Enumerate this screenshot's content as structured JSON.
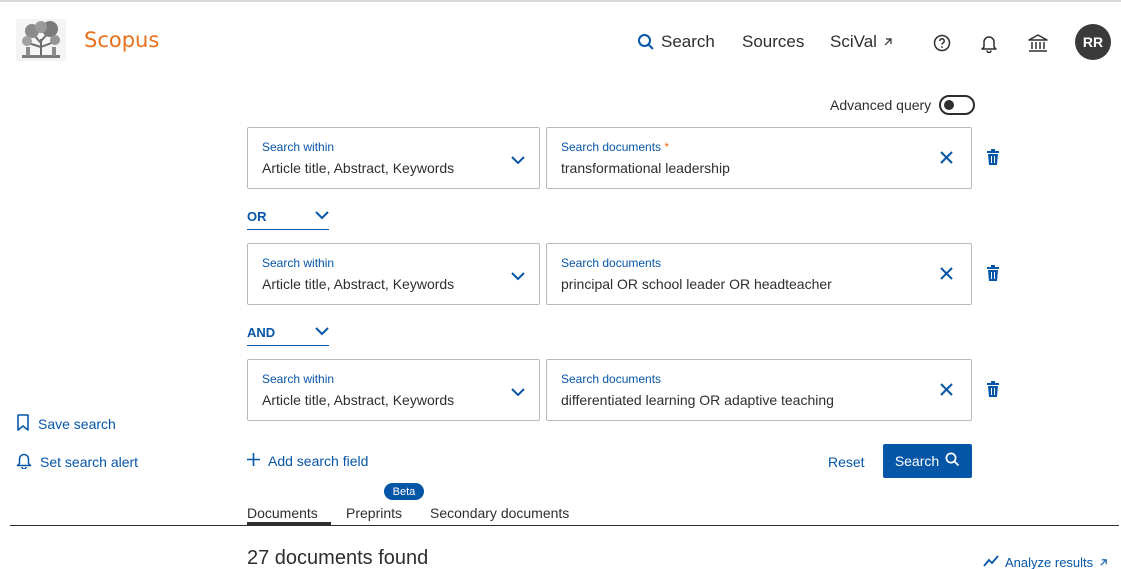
{
  "header": {
    "brand": "Scopus",
    "nav": {
      "search": "Search",
      "sources": "Sources",
      "scival": "SciVal"
    },
    "avatar_initials": "RR",
    "icons": [
      "help-icon",
      "bell-icon",
      "institution-icon"
    ]
  },
  "advanced_query_label": "Advanced query",
  "rows": [
    {
      "within_label": "Search within",
      "within_value": "Article title, Abstract, Keywords",
      "docs_label": "Search documents",
      "required_mark": "*",
      "docs_value": "transformational leadership"
    },
    {
      "within_label": "Search within",
      "within_value": "Article title, Abstract, Keywords",
      "docs_label": "Search documents",
      "docs_value": "principal OR school leader OR headteacher"
    },
    {
      "within_label": "Search within",
      "within_value": "Article title, Abstract, Keywords",
      "docs_label": "Search documents",
      "docs_value": "differentiated learning OR adaptive teaching"
    }
  ],
  "operators": [
    "OR",
    "AND"
  ],
  "sidebar": {
    "save_search": "Save search",
    "set_alert": "Set search alert"
  },
  "actions": {
    "add_field": "Add search field",
    "reset": "Reset",
    "search": "Search"
  },
  "tabs": {
    "documents": "Documents",
    "preprints": "Preprints",
    "beta": "Beta",
    "secondary": "Secondary documents"
  },
  "results": {
    "found": "27 documents found",
    "analyze": "Analyze results"
  },
  "colors": {
    "brand": "#e9711c",
    "link": "#0656a8",
    "text": "#2e2e2e"
  }
}
